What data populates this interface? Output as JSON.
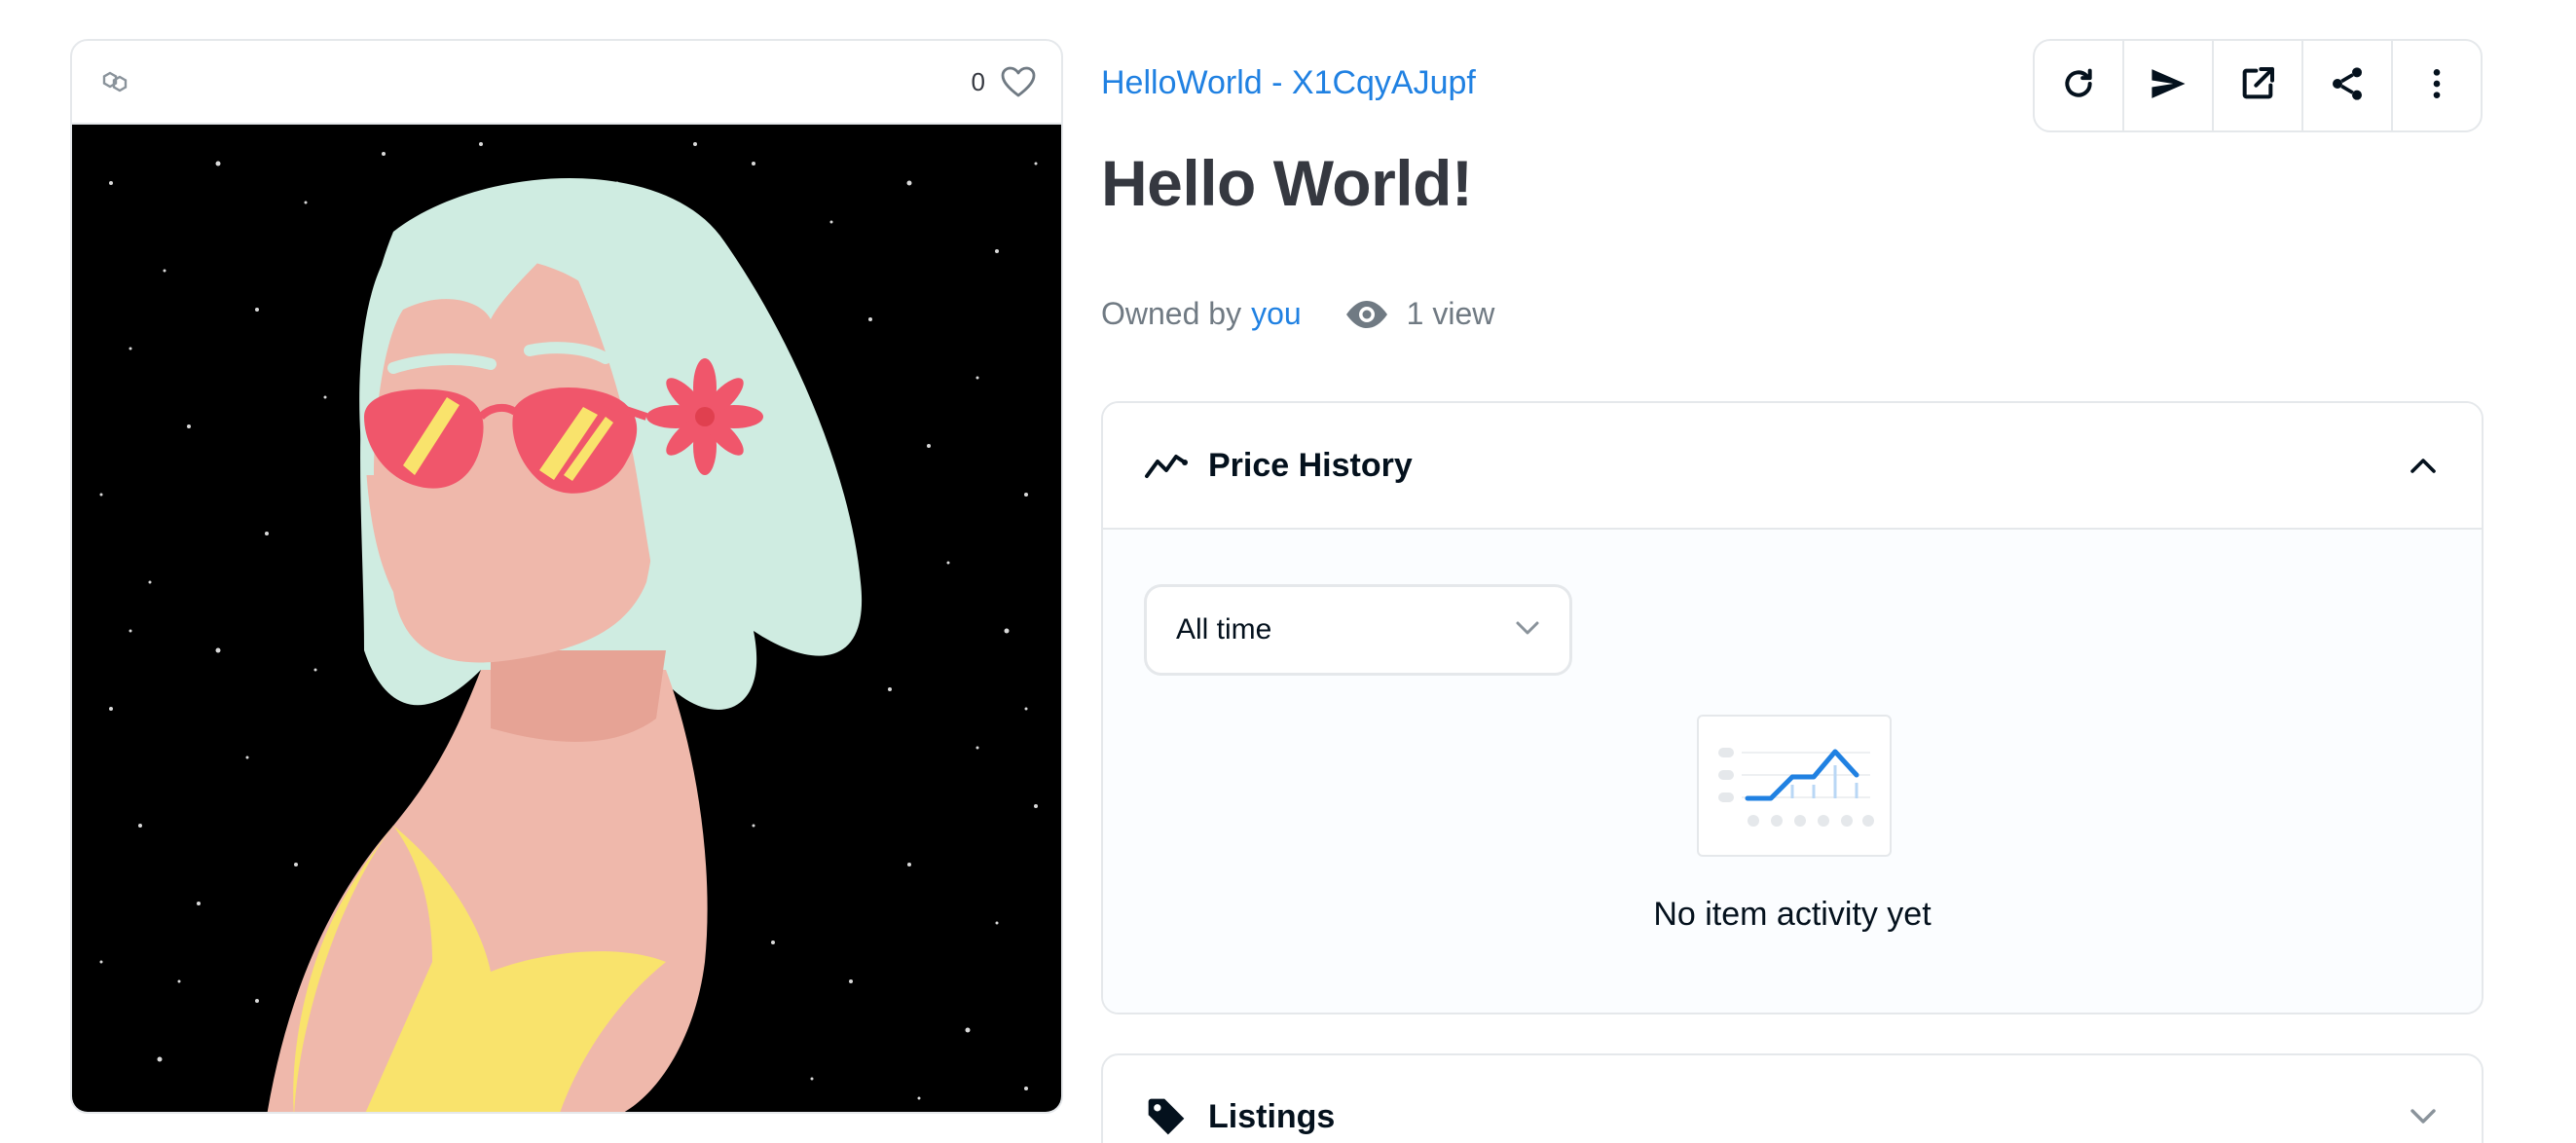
{
  "media": {
    "favorites_count": "0",
    "chain_icon": "polygon-chain-icon",
    "favorite_icon": "heart-icon"
  },
  "item": {
    "collection_name": "HelloWorld - X1CqyAJupf",
    "title": "Hello World!",
    "owned_by_label": "Owned by",
    "owner": "you",
    "views": "1 view"
  },
  "toolbar": {
    "buttons": [
      "refresh-icon",
      "transfer-icon",
      "external-link-icon",
      "share-icon",
      "more-icon"
    ]
  },
  "price_history": {
    "title": "Price History",
    "expanded": true,
    "range_select": {
      "value": "All time",
      "options_visible": [
        "All time"
      ]
    },
    "empty_message": "No item activity yet"
  },
  "listings": {
    "title": "Listings",
    "expanded": false
  },
  "colors": {
    "accent": "#2081e2",
    "text_primary": "#04111d",
    "text_heading": "#353840",
    "text_muted": "#707a83",
    "border": "#e5e8eb"
  }
}
